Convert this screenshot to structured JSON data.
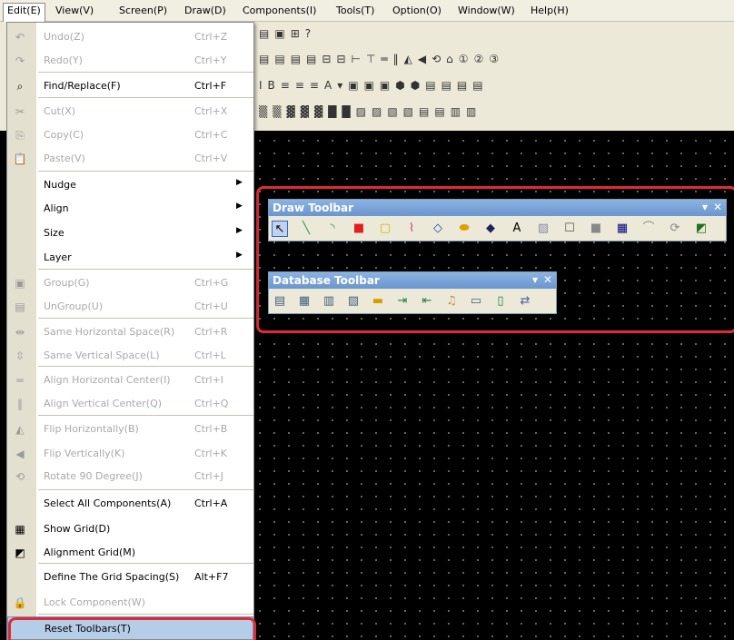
{
  "menubar": {
    "items": [
      {
        "label": "Edit(E)",
        "active": true
      },
      {
        "label": "View(V)"
      },
      {
        "label": "Screen(P)"
      },
      {
        "label": "Draw(D)"
      },
      {
        "label": "Components(I)"
      },
      {
        "label": "Tools(T)"
      },
      {
        "label": "Option(O)"
      },
      {
        "label": "Window(W)"
      },
      {
        "label": "Help(H)"
      }
    ]
  },
  "edit_menu": {
    "items": [
      {
        "icon": "undo-icon",
        "glyph": "↶",
        "label": "Undo(Z)",
        "shortcut": "Ctrl+Z",
        "enabled": false
      },
      {
        "icon": "redo-icon",
        "glyph": "↷",
        "label": "Redo(Y)",
        "shortcut": "Ctrl+Y",
        "enabled": false
      },
      {
        "icon": "binoculars-icon",
        "glyph": "⌕",
        "label": "Find/Replace(F)",
        "shortcut": "Ctrl+F",
        "enabled": true
      },
      {
        "icon": "cut-icon",
        "glyph": "✂",
        "label": "Cut(X)",
        "shortcut": "Ctrl+X",
        "enabled": false
      },
      {
        "icon": "copy-icon",
        "glyph": "⎘",
        "label": "Copy(C)",
        "shortcut": "Ctrl+C",
        "enabled": false
      },
      {
        "icon": "paste-icon",
        "glyph": "📋",
        "label": "Paste(V)",
        "shortcut": "Ctrl+V",
        "enabled": false
      },
      {
        "label": "Nudge",
        "submenu": true,
        "enabled": true
      },
      {
        "label": "Align",
        "submenu": true,
        "enabled": true
      },
      {
        "label": "Size",
        "submenu": true,
        "enabled": true
      },
      {
        "label": "Layer",
        "submenu": true,
        "enabled": true
      },
      {
        "icon": "group-icon",
        "glyph": "▣",
        "label": "Group(G)",
        "shortcut": "Ctrl+G",
        "enabled": false
      },
      {
        "icon": "ungroup-icon",
        "glyph": "▤",
        "label": "UnGroup(U)",
        "shortcut": "Ctrl+U",
        "enabled": false
      },
      {
        "icon": "same-horizontal-space-icon",
        "glyph": "⇹",
        "label": "Same Horizontal Space(R)",
        "shortcut": "Ctrl+R",
        "enabled": false
      },
      {
        "icon": "same-vertical-space-icon",
        "glyph": "⇳",
        "label": "Same Vertical Space(L)",
        "shortcut": "Ctrl+L",
        "enabled": false
      },
      {
        "icon": "align-horizontal-center-icon",
        "glyph": "═",
        "label": "Align Horizontal Center(I)",
        "shortcut": "Ctrl+I",
        "enabled": false
      },
      {
        "icon": "align-vertical-center-icon",
        "glyph": "‖",
        "label": "Align Vertical Center(Q)",
        "shortcut": "Ctrl+Q",
        "enabled": false
      },
      {
        "icon": "flip-horizontal-icon",
        "glyph": "◭",
        "label": "Flip Horizontally(B)",
        "shortcut": "Ctrl+B",
        "enabled": false
      },
      {
        "icon": "flip-vertical-icon",
        "glyph": "◀",
        "label": "Flip Vertically(K)",
        "shortcut": "Ctrl+K",
        "enabled": false
      },
      {
        "icon": "rotate-icon",
        "glyph": "⟲",
        "label": "Rotate 90 Degree(J)",
        "shortcut": "Ctrl+J",
        "enabled": false
      },
      {
        "label": "Select All Components(A)",
        "shortcut": "Ctrl+A",
        "enabled": true
      },
      {
        "icon": "show-grid-icon",
        "glyph": "▦",
        "label": "Show Grid(D)",
        "enabled": true
      },
      {
        "icon": "alignment-grid-icon",
        "glyph": "◩",
        "label": "Alignment Grid(M)",
        "enabled": true
      },
      {
        "label": "Define The Grid Spacing(S)",
        "shortcut": "Alt+F7",
        "enabled": true
      },
      {
        "icon": "lock-icon",
        "glyph": "🔒",
        "label": "Lock Component(W)",
        "enabled": false
      },
      {
        "label": "Reset Toolbars(T)",
        "enabled": true,
        "highlighted": true
      }
    ]
  },
  "draw_toolbar": {
    "title": "Draw Toolbar",
    "tools": [
      {
        "icon": "pointer-icon",
        "glyph": "↖",
        "color": "#000000"
      },
      {
        "icon": "line-icon",
        "glyph": "╲",
        "color": "#2e8b57"
      },
      {
        "icon": "arc-icon",
        "glyph": "◝",
        "color": "#2e8b57"
      },
      {
        "icon": "rectangle-icon",
        "glyph": "■",
        "color": "#e02020"
      },
      {
        "icon": "rounded-rectangle-icon",
        "glyph": "▢",
        "color": "#d4b000"
      },
      {
        "icon": "polyline-icon",
        "glyph": "⌇",
        "color": "#c04080"
      },
      {
        "icon": "polygon-icon",
        "glyph": "◇",
        "color": "#2040c0"
      },
      {
        "icon": "ellipse-icon",
        "glyph": "⬬",
        "color": "#e0a000"
      },
      {
        "icon": "diamond-icon",
        "glyph": "◆",
        "color": "#202060"
      },
      {
        "icon": "text-icon",
        "glyph": "A",
        "color": "#000000"
      },
      {
        "icon": "image-icon",
        "glyph": "▨",
        "color": "#8888aa"
      },
      {
        "icon": "border-style-icon",
        "glyph": "☐",
        "color": "#555555"
      },
      {
        "icon": "fill-color-icon",
        "glyph": "■",
        "color": "#888888"
      },
      {
        "icon": "grid-toggle-icon",
        "glyph": "▦",
        "color": "#000080"
      },
      {
        "icon": "curve-icon",
        "glyph": "⌒",
        "color": "#888888"
      },
      {
        "icon": "refresh-icon",
        "glyph": "⟳",
        "color": "#888888"
      },
      {
        "icon": "alignment-grid-icon",
        "glyph": "◩",
        "color": "#207020"
      }
    ]
  },
  "database_toolbar": {
    "title": "Database Toolbar",
    "tools": [
      {
        "icon": "db-table-icon",
        "glyph": "▤",
        "color": "#406080"
      },
      {
        "icon": "db-grid-icon",
        "glyph": "▦",
        "color": "#406080"
      },
      {
        "icon": "db-form-icon",
        "glyph": "▥",
        "color": "#406080"
      },
      {
        "icon": "db-list-icon",
        "glyph": "▧",
        "color": "#406080"
      },
      {
        "icon": "db-folder-icon",
        "glyph": "▬",
        "color": "#d4a000"
      },
      {
        "icon": "db-export-icon",
        "glyph": "⇥",
        "color": "#208040"
      },
      {
        "icon": "db-import-icon",
        "glyph": "⇤",
        "color": "#208040"
      },
      {
        "icon": "db-music-icon",
        "glyph": "♫",
        "color": "#c09050"
      },
      {
        "icon": "db-report-icon",
        "glyph": "▭",
        "color": "#406080"
      },
      {
        "icon": "db-new-icon",
        "glyph": "▯",
        "color": "#208040"
      },
      {
        "icon": "db-sync-icon",
        "glyph": "⇄",
        "color": "#4060a0"
      }
    ]
  }
}
